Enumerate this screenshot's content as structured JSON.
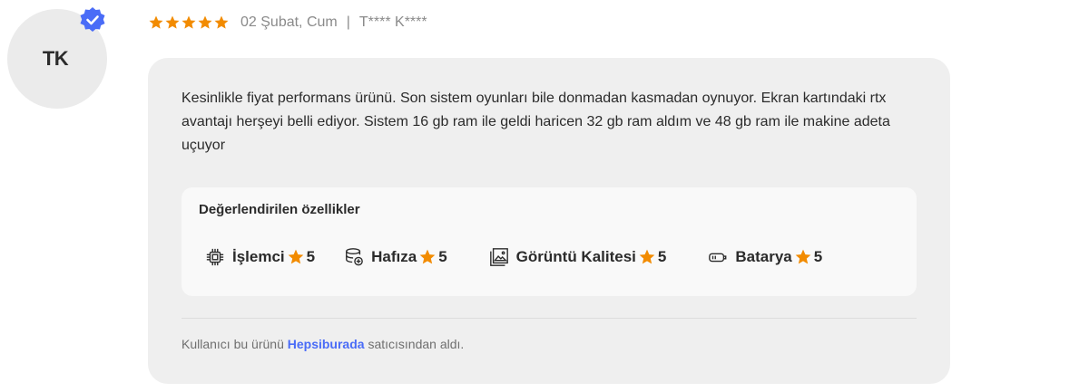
{
  "reviewer": {
    "initials": "TK",
    "name_masked": "T**** K****",
    "verified": true
  },
  "rating": {
    "stars": 5,
    "max": 5
  },
  "date": "02 Şubat, Cum",
  "separator": "|",
  "review": {
    "text": "Kesinlikle fiyat performans ürünü. Son sistem oyunları bile donmadan kasmadan oynuyor. Ekran kartındaki rtx avantajı herşeyi belli ediyor. Sistem 16 gb ram ile geldi haricen 32 gb ram aldım ve 48 gb ram ile makine adeta uçuyor"
  },
  "features": {
    "title": "Değerlendirilen özellikler",
    "items": [
      {
        "label": "İşlemci",
        "score": "5",
        "icon": "cpu-icon"
      },
      {
        "label": "Hafıza",
        "score": "5",
        "icon": "storage-icon"
      },
      {
        "label": "Görüntü Kalitesi",
        "score": "5",
        "icon": "image-quality-icon"
      },
      {
        "label": "Batarya",
        "score": "5",
        "icon": "battery-icon"
      }
    ]
  },
  "seller": {
    "prefix": "Kullanıcı bu ürünü",
    "name": "Hepsiburada",
    "suffix": "satıcısından aldı."
  },
  "colors": {
    "star": "#f28b00",
    "verified": "#4a6cf7",
    "link": "#4a6cf7",
    "card_bg": "#efefef",
    "features_bg": "#f9f9f9"
  }
}
